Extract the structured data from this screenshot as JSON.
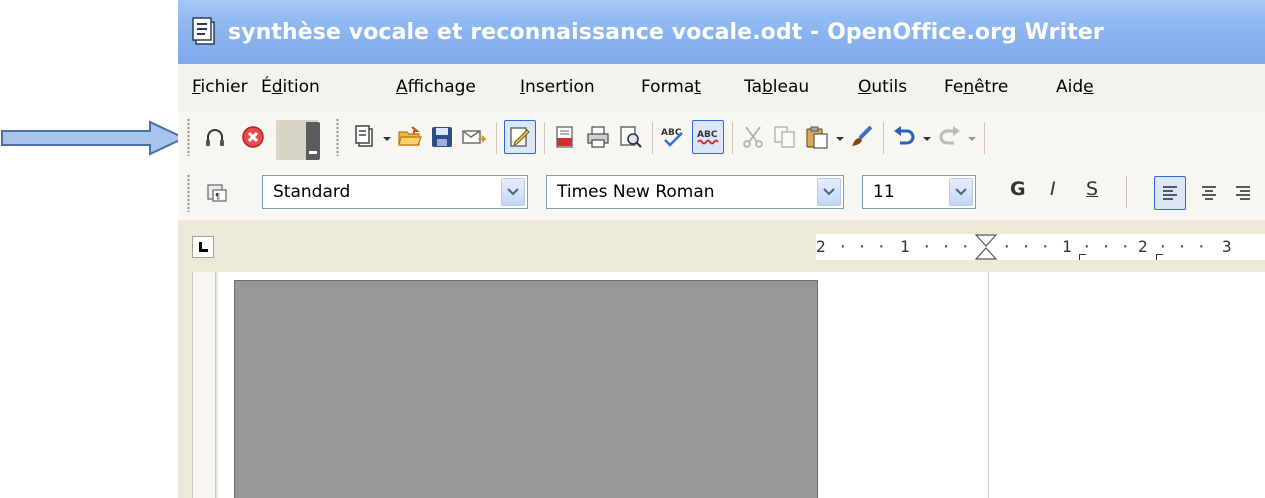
{
  "window": {
    "title": "synthèse vocale et reconnaissance vocale.odt - OpenOffice.org Writer",
    "icon": "writer-document-icon",
    "titlebar_color": "#8db6f0"
  },
  "menu": {
    "items": [
      {
        "pre": "",
        "key": "F",
        "post": "ichier"
      },
      {
        "pre": "É",
        "key": "d",
        "post": "ition"
      },
      {
        "pre": "",
        "key": "A",
        "post": "ffichage"
      },
      {
        "pre": "",
        "key": "I",
        "post": "nsertion"
      },
      {
        "pre": "Forma",
        "key": "t",
        "post": ""
      },
      {
        "pre": "Ta",
        "key": "b",
        "post": "leau"
      },
      {
        "pre": "",
        "key": "O",
        "post": "utils"
      },
      {
        "pre": "Fe",
        "key": "n",
        "post": "être"
      },
      {
        "pre": "Aid",
        "key": "e",
        "post": ""
      }
    ]
  },
  "standard_toolbar": {
    "icons": [
      "headphones-icon",
      "stop-icon",
      "toolbar-overflow-icon",
      "new-document-icon",
      "open-folder-icon",
      "save-icon",
      "email-icon",
      "edit-mode-icon",
      "export-pdf-icon",
      "print-icon",
      "page-preview-icon",
      "spellcheck-icon",
      "autospellcheck-icon",
      "cut-icon",
      "copy-icon",
      "paste-icon",
      "format-paintbrush-icon",
      "undo-icon",
      "redo-icon"
    ]
  },
  "formatting_toolbar": {
    "style_value": "Standard",
    "font_value": "Times New Roman",
    "size_value": "11",
    "bold_label": "G",
    "italic_label": "I",
    "underline_label": "S"
  },
  "ruler": {
    "labels": [
      "2",
      "1",
      "1",
      "2",
      "3"
    ]
  },
  "annotation": {
    "arrow_color": "#a9c4ec"
  }
}
